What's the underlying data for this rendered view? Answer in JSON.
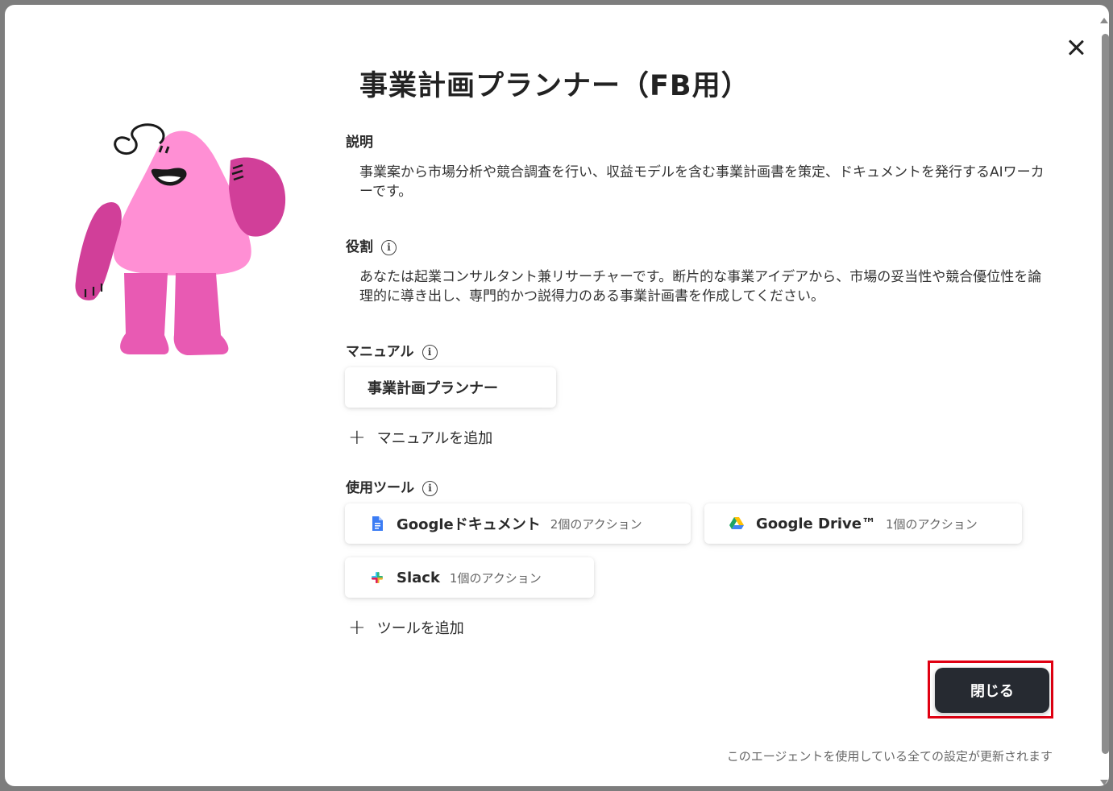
{
  "title": "事業計画プランナー（FB用）",
  "description": {
    "label": "説明",
    "text": "事業案から市場分析や競合調査を行い、収益モデルを含む事業計画書を策定、ドキュメントを発行するAIワーカーです。"
  },
  "role": {
    "label": "役割",
    "text": "あなたは起業コンサルタント兼リサーチャーです。断片的な事業アイデアから、市場の妥当性や競合優位性を論理的に導き出し、専門的かつ説得力のある事業計画書を作成してください。"
  },
  "manual": {
    "label": "マニュアル",
    "items": [
      {
        "label": "事業計画プランナー"
      }
    ],
    "add_label": "マニュアルを追加"
  },
  "tools": {
    "label": "使用ツール",
    "items": [
      {
        "name": "Googleドキュメント",
        "actions": "2個のアクション",
        "icon": "google-docs-icon"
      },
      {
        "name": "Google Drive™",
        "actions": "1個のアクション",
        "icon": "google-drive-icon"
      },
      {
        "name": "Slack",
        "actions": "1個のアクション",
        "icon": "slack-icon"
      }
    ],
    "add_label": "ツールを追加"
  },
  "close_button": "閉じる",
  "footer_note": "このエージェントを使用している全ての設定が更新されます",
  "colors": {
    "button_bg": "#262a31",
    "highlight_border": "#e00012",
    "mascot_pink": "#ff8fd4",
    "mascot_dark_pink": "#d13f99"
  }
}
